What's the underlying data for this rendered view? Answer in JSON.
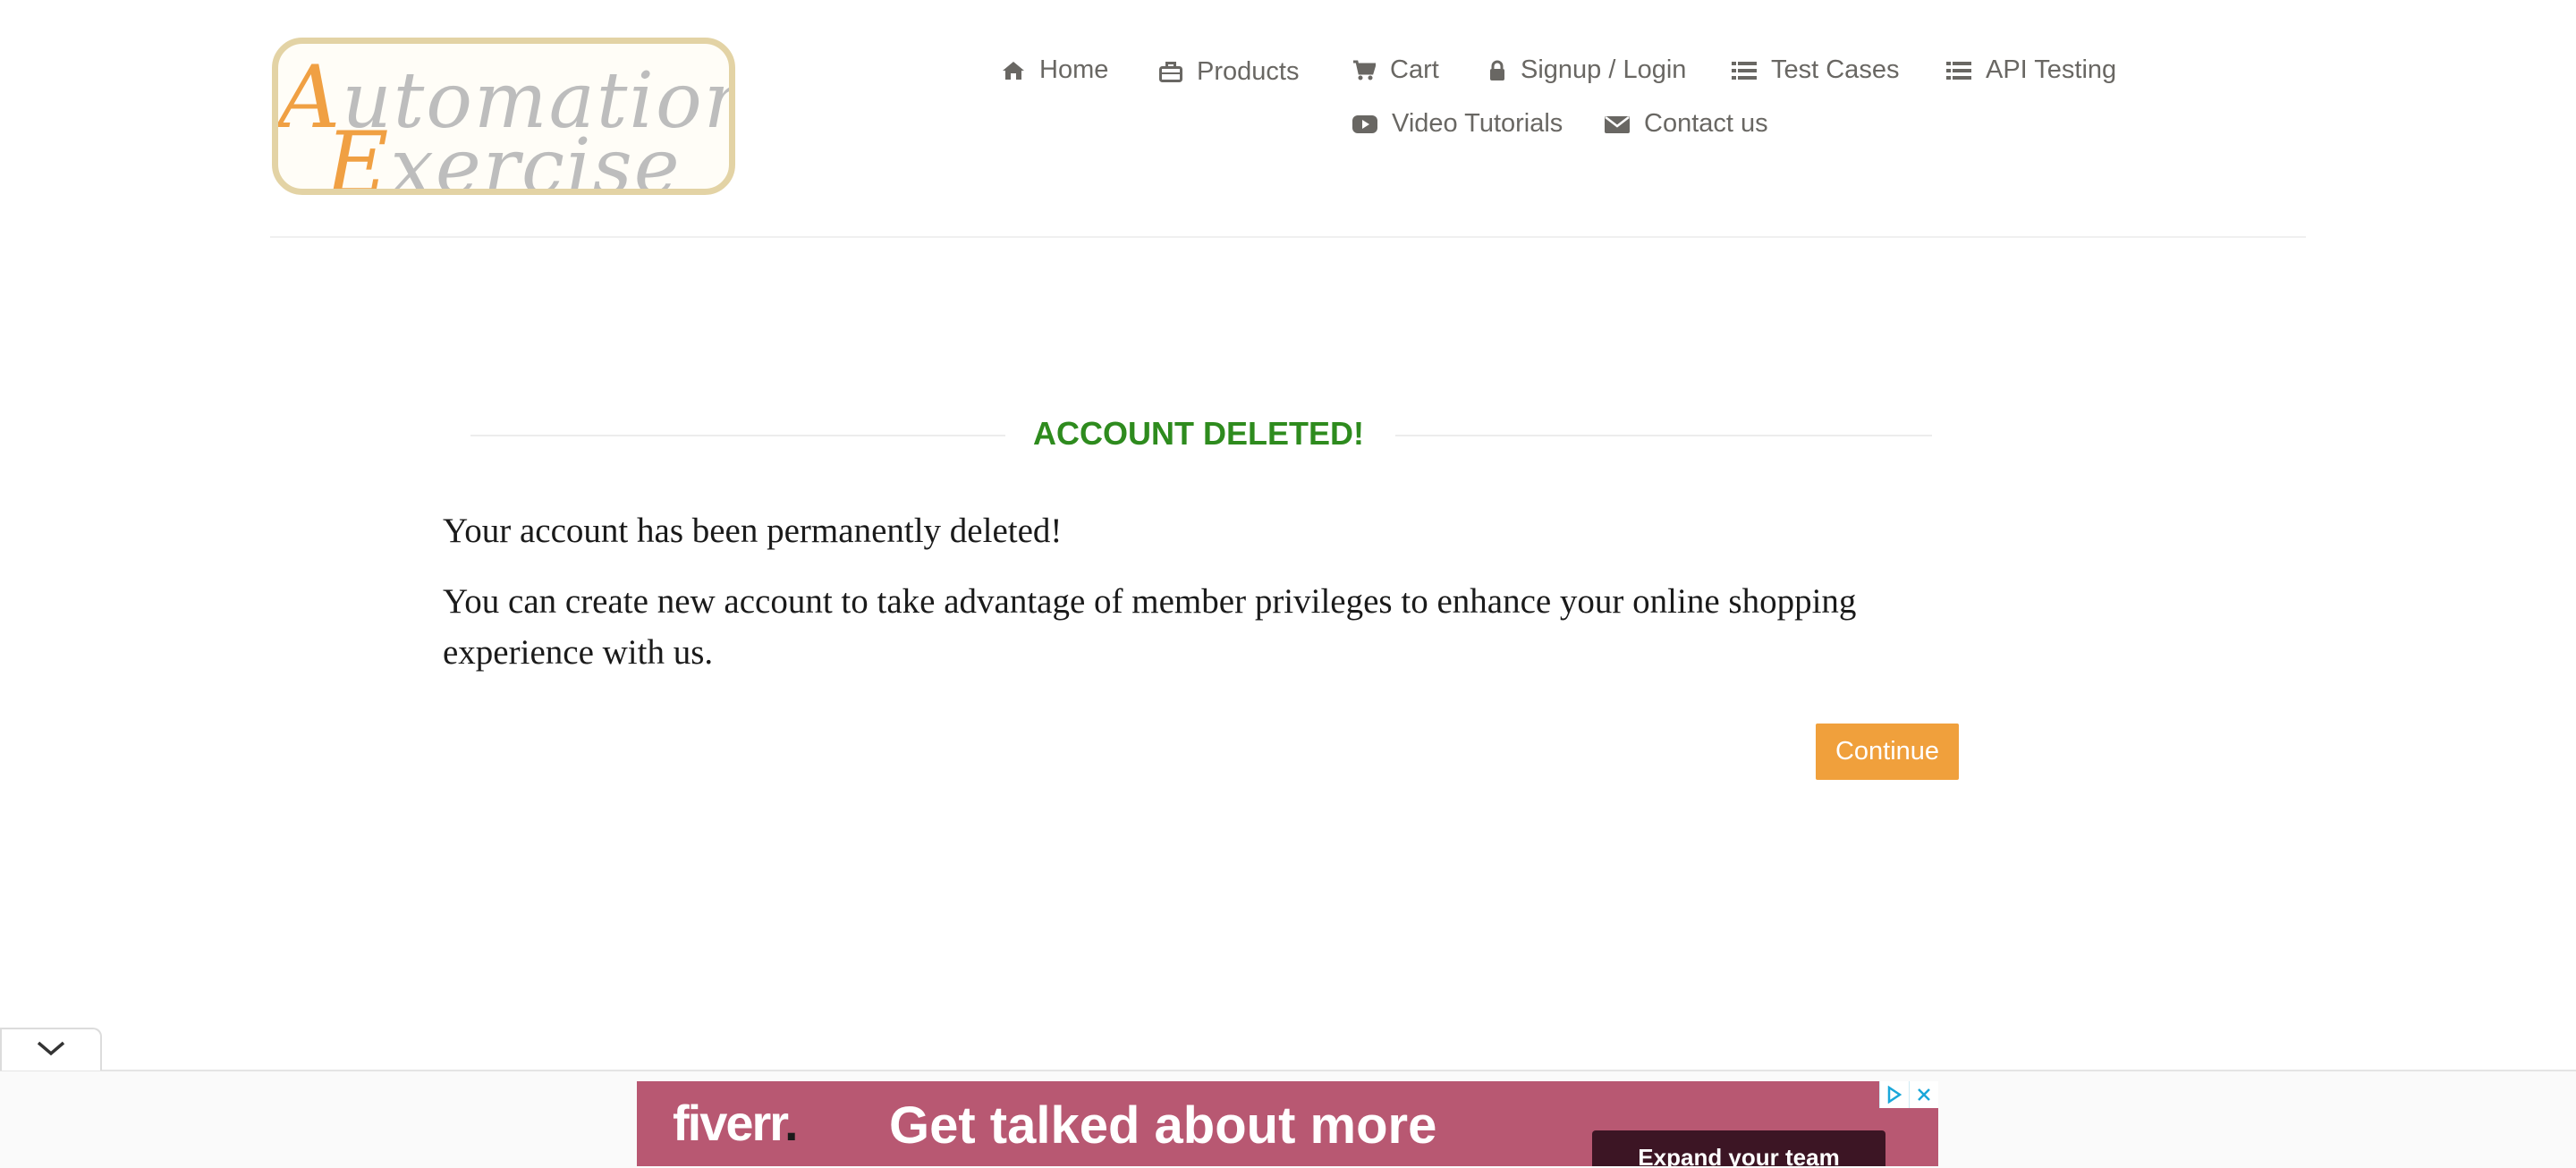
{
  "header": {
    "logo": {
      "line1": "Automation",
      "line2": "Exercise"
    },
    "nav": [
      {
        "label": "Home",
        "icon": "home-icon"
      },
      {
        "label": "Products",
        "icon": "briefcase-icon"
      },
      {
        "label": "Cart",
        "icon": "cart-icon"
      },
      {
        "label": "Signup / Login",
        "icon": "lock-icon"
      },
      {
        "label": "Test Cases",
        "icon": "list-icon"
      },
      {
        "label": "API Testing",
        "icon": "list-icon"
      },
      {
        "label": "Video Tutorials",
        "icon": "youtube-play-icon"
      },
      {
        "label": "Contact us",
        "icon": "envelope-icon"
      }
    ]
  },
  "main": {
    "title": "ACCOUNT DELETED!",
    "message_1": "Your account has been permanently deleted!",
    "message_2": "You can create new account to take advantage of member privileges to enhance your online shopping experience with us.",
    "continue_label": "Continue"
  },
  "ad": {
    "brand": "fiverr",
    "headline": "Get talked about more",
    "cta": "Expand your team"
  },
  "colors": {
    "accent": "#f0a03c",
    "success": "#2e8b1e",
    "nav_text": "#696763",
    "ad_background": "#b85872"
  }
}
